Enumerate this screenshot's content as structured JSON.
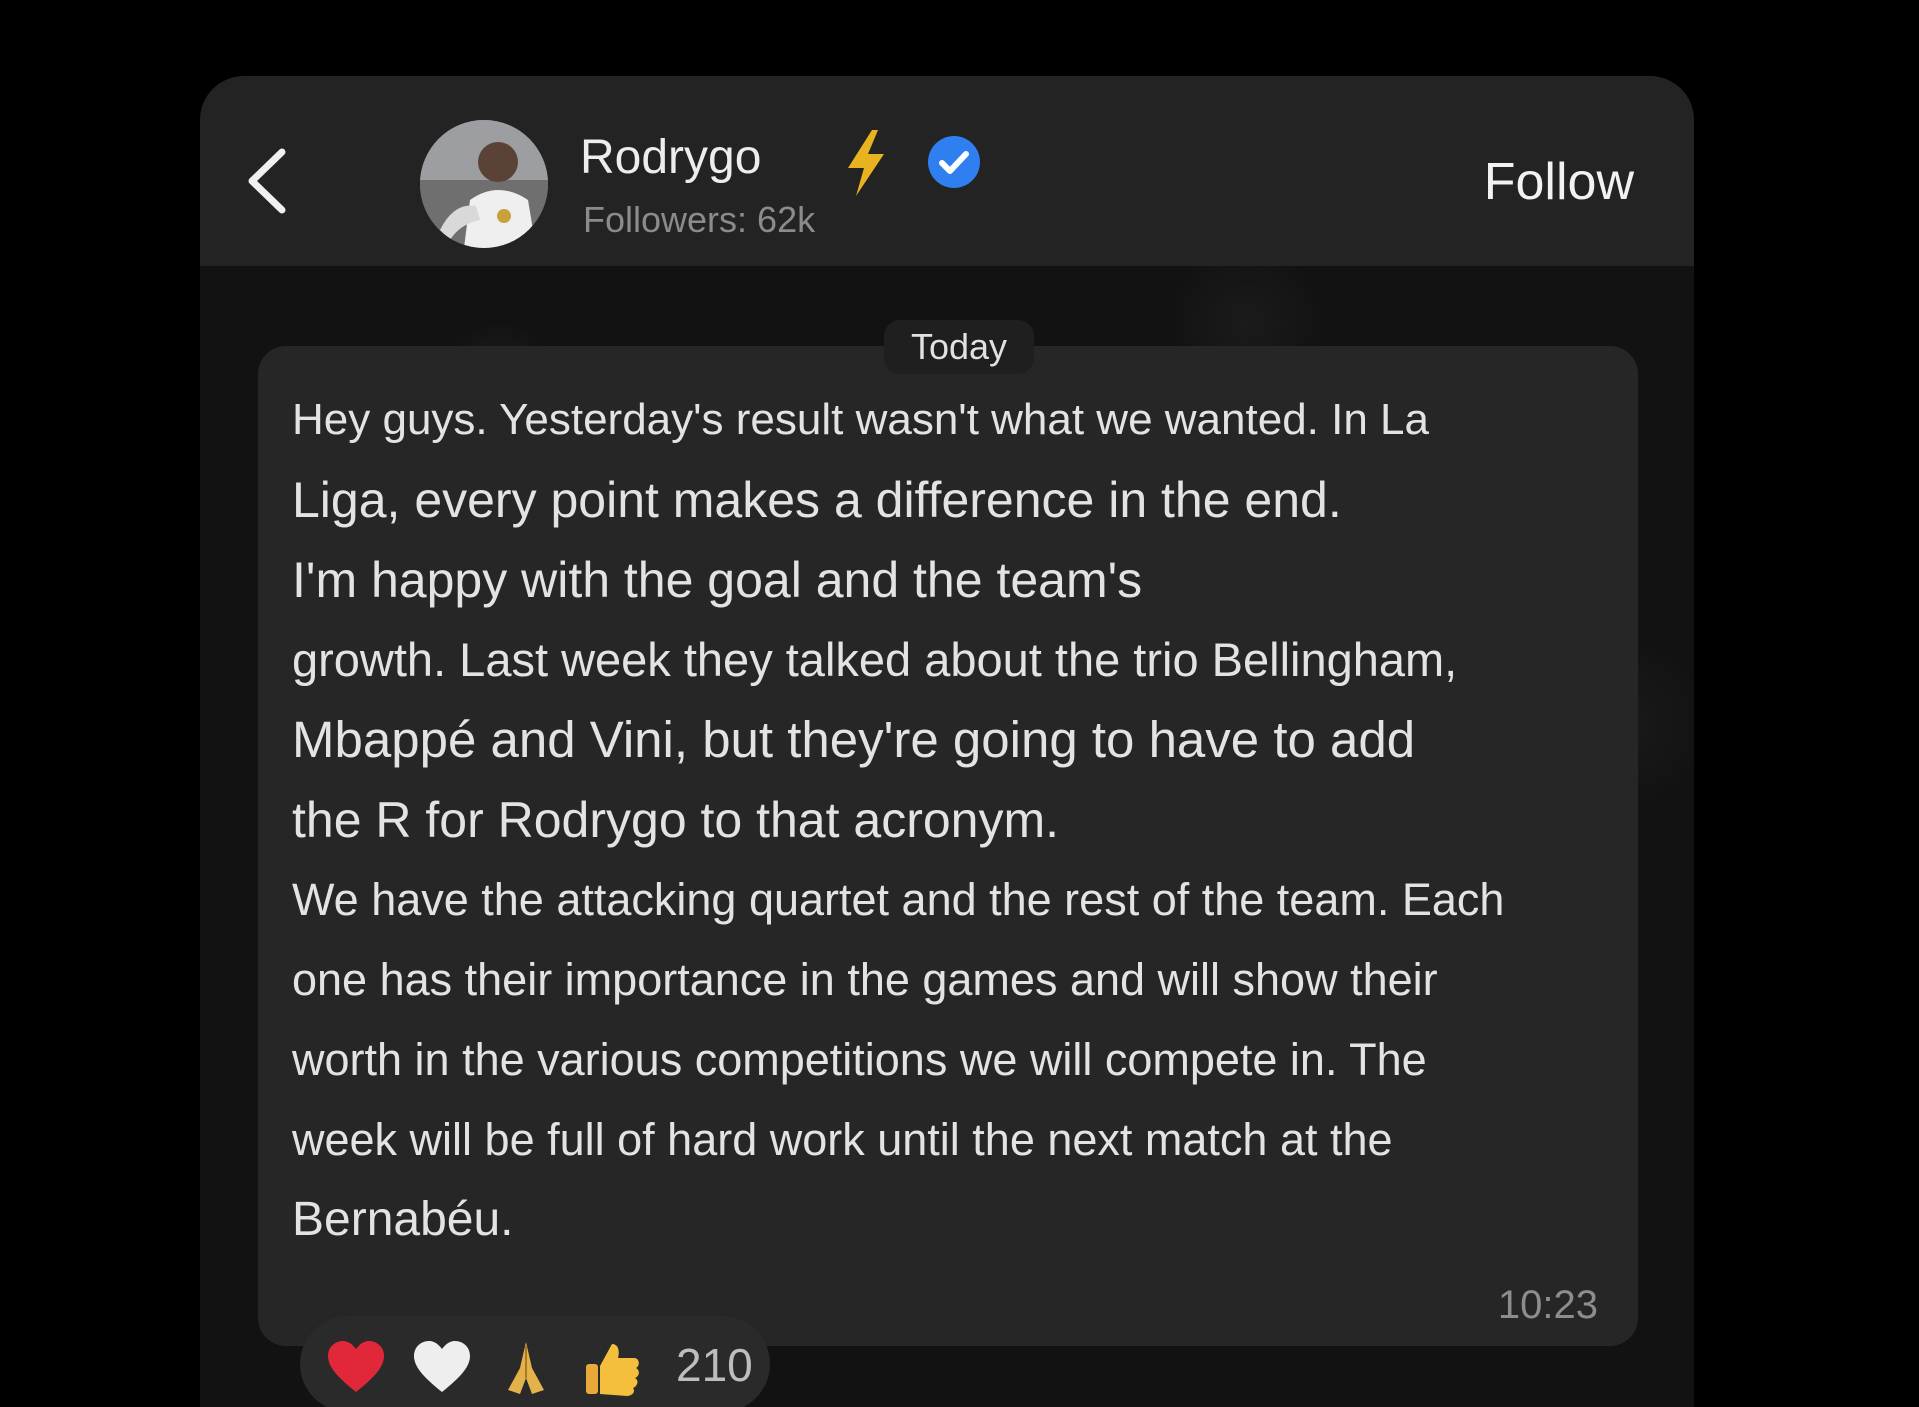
{
  "header": {
    "name": "Rodrygo",
    "followers": "Followers: 62k",
    "follow_label": "Follow",
    "back_icon": "chevron-left-icon",
    "badges": [
      "lightning-icon",
      "verified-icon"
    ]
  },
  "chat": {
    "date_label": "Today",
    "message_lines": [
      "Hey guys. Yesterday's result wasn't what we wanted. In La",
      "Liga, every point makes a difference in the end.",
      "I'm happy with the goal and the team's",
      "growth. Last week they talked about the trio Bellingham,",
      "Mbappé and Vini, but they're going to have to add",
      "the R for Rodrygo to that acronym.",
      "We have the attacking quartet and the rest of the team. Each",
      "one has their importance in the games and will show their",
      "worth in the various competitions we will compete in. The",
      "week will be full of hard work until the next match at the",
      "Bernabéu."
    ],
    "timestamp": "10:23"
  },
  "reactions": {
    "emojis": [
      "red-heart-icon",
      "white-heart-icon",
      "praying-hands-icon",
      "thumbs-up-icon"
    ],
    "count": "210"
  },
  "colors": {
    "background": "#000000",
    "header": "#232323",
    "bubble": "#262626",
    "verified_blue": "#2f7ff0",
    "bolt_yellow": "#e9b21f",
    "heart_red": "#e0283a"
  }
}
